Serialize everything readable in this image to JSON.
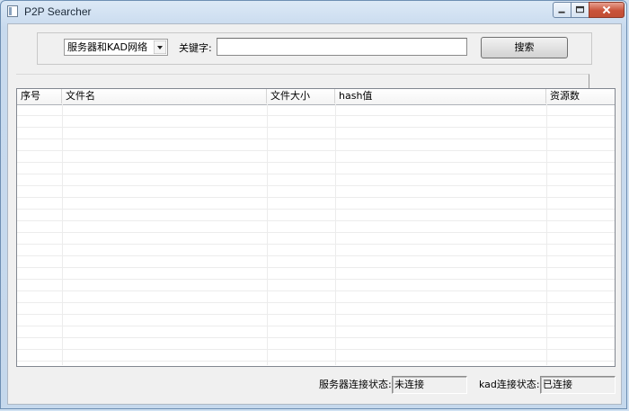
{
  "window": {
    "title": "P2P Searcher",
    "controls": {
      "minimize": "minimize-icon",
      "maximize": "maximize-icon",
      "close": "close-icon"
    }
  },
  "search": {
    "network_select_value": "服务器和KAD网络",
    "keyword_label": "关键字:",
    "keyword_value": "",
    "button_label": "搜索"
  },
  "results": {
    "columns": [
      "序号",
      "文件名",
      "文件大小",
      "hash值",
      "资源数"
    ],
    "rows": []
  },
  "status": {
    "server_label": "服务器连接状态:",
    "server_value": "未连接",
    "kad_label": "kad连接状态:",
    "kad_value": "已连接"
  }
}
